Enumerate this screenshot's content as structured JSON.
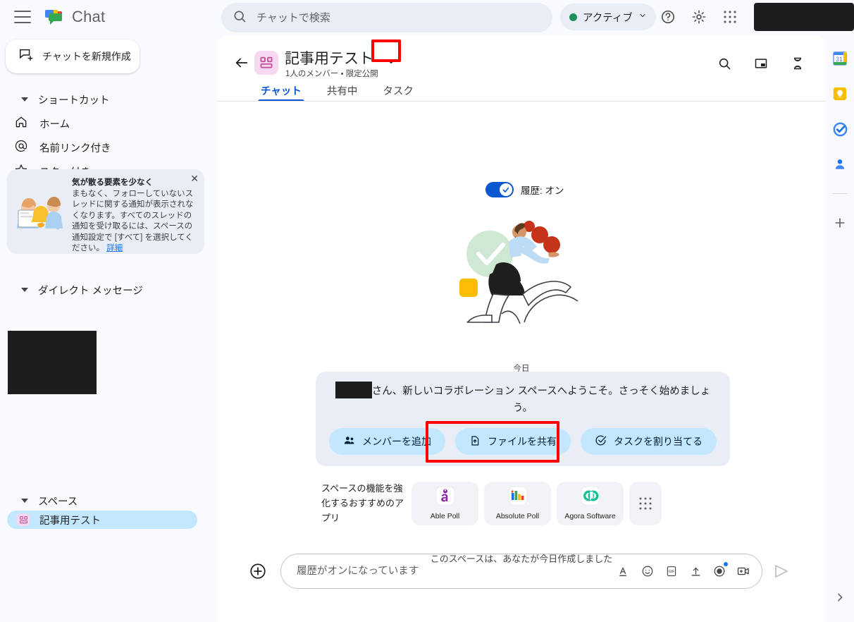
{
  "topbar": {
    "menu_icon": "hamburger-menu-icon",
    "logo_icon": "google-chat-logo",
    "brand": "Chat",
    "search": {
      "placeholder": "チャットで検索",
      "value": "",
      "icon": "search-icon"
    },
    "status": {
      "label": "アクティブ",
      "dot_color": "#1e8e5a",
      "chevron": "chevron-down-icon"
    },
    "help_icon": "help-circle-icon",
    "settings_icon": "gear-icon",
    "apps_icon": "apps-grid-icon",
    "avatar": "redacted-avatar"
  },
  "sidebar": {
    "new_chat": {
      "label": "チャットを新規作成",
      "icon": "compose-new-chat-icon"
    },
    "shortcuts": {
      "label": "ショートカット",
      "items": [
        {
          "label": "ホーム",
          "icon": "home-icon"
        },
        {
          "label": "名前リンク付き",
          "icon": "at-mention-icon"
        },
        {
          "label": "スター付き",
          "icon": "star-icon"
        }
      ]
    },
    "promo": {
      "title": "気が散る要素を少なく",
      "body": "まもなく、フォローしていないスレッドに関する通知が表示されなくなります。すべてのスレッドの通知を受け取るには、スペースの通知設定で [すべて] を選択してください。",
      "link": "詳細",
      "close_icon": "close-icon",
      "illustration": "bell-notification-illustration"
    },
    "direct_messages": {
      "label": "ダイレクト メッセージ",
      "redacted": ""
    },
    "spaces": {
      "label": "スペース",
      "items": [
        {
          "label": "記事用テスト",
          "icon": "space-avatar-icon",
          "selected": true
        }
      ]
    }
  },
  "space_header": {
    "back_icon": "back-arrow-icon",
    "avatar_icon": "space-avatar-icon",
    "title": "記事用テスト",
    "title_chevron": "chevron-down-icon",
    "subtitle": "1人のメンバー ・ 限定公開",
    "actions": [
      {
        "icon": "search-icon"
      },
      {
        "icon": "open-in-pip-icon"
      },
      {
        "icon": "hourglass-icon"
      }
    ],
    "tabs": [
      {
        "label": "チャット",
        "active": true
      },
      {
        "label": "共有中",
        "active": false
      },
      {
        "label": "タスク",
        "active": false
      }
    ]
  },
  "conversation": {
    "history_toggle": {
      "label": "履歴: オン",
      "on": true,
      "icon": "check-icon"
    },
    "illustration": "person-with-checkmark-illustration",
    "day_divider": "今日",
    "welcome": {
      "redacted_name": "",
      "text": "さん、新しいコラボレーション スペースへようこそ。さっそく始めましょう。",
      "actions": [
        {
          "label": "メンバーを追加",
          "icon": "add-people-icon",
          "highlighted": true
        },
        {
          "label": "ファイルを共有",
          "icon": "file-share-icon",
          "highlighted": false
        },
        {
          "label": "タスクを割り当てる",
          "icon": "assign-task-icon",
          "highlighted": false
        }
      ]
    },
    "apps": {
      "caption": "スペースの機能を強化するおすすめのアプリ",
      "items": [
        {
          "name": "Able Poll",
          "icon": "able-poll-app-icon"
        },
        {
          "name": "Absolute Poll",
          "icon": "absolute-poll-app-icon"
        },
        {
          "name": "Agora Software",
          "icon": "agora-software-app-icon"
        }
      ],
      "more_icon": "apps-grid-icon"
    },
    "created_note": "このスペースは、あなたが今日作成しました"
  },
  "composer": {
    "add_icon": "plus-circle-icon",
    "placeholder": "履歴がオンになっています",
    "value": "",
    "icons": [
      {
        "icon": "format-text-icon"
      },
      {
        "icon": "emoji-icon"
      },
      {
        "icon": "gif-icon"
      },
      {
        "icon": "upload-icon"
      },
      {
        "icon": "record-icon",
        "badge": true
      },
      {
        "icon": "video-meet-icon"
      }
    ],
    "send_icon": "send-icon"
  },
  "right_rail": {
    "items": [
      {
        "icon": "google-calendar-icon"
      },
      {
        "icon": "google-keep-icon"
      },
      {
        "icon": "google-tasks-icon"
      },
      {
        "icon": "google-contacts-icon"
      }
    ],
    "add_icon": "plus-icon",
    "expand_icon": "chevron-right-icon"
  },
  "colors": {
    "accent_blue": "#0b57d0",
    "chip_blue": "#c2e7ff",
    "panel_bg": "#ffffff",
    "app_bg": "#f8fafd",
    "highlight_red": "#ff0000",
    "status_green": "#1e8e5a"
  }
}
